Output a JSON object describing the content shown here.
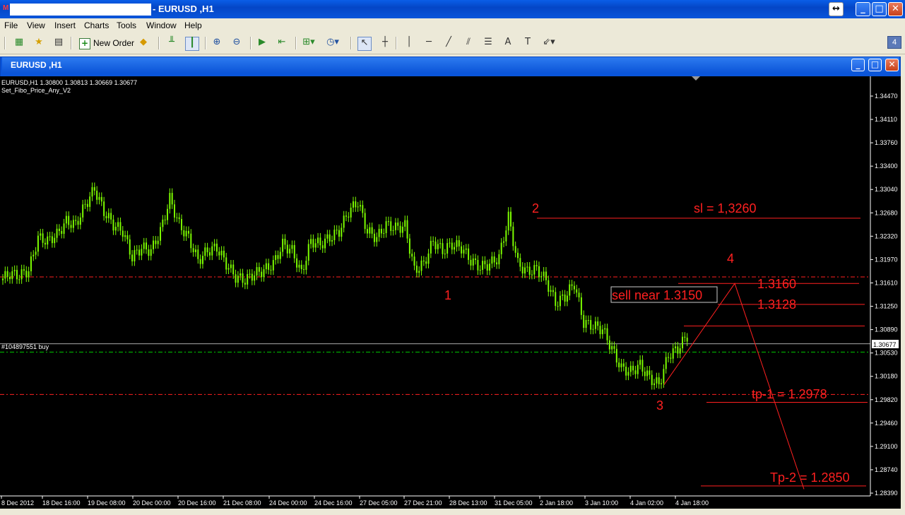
{
  "window": {
    "title": "- EURUSD ,H1",
    "app_icon": "M"
  },
  "menu": [
    "File",
    "View",
    "Insert",
    "Charts",
    "Tools",
    "Window",
    "Help"
  ],
  "toolbar": {
    "new_order_label": "New Order",
    "badge": "4"
  },
  "inner_window": {
    "title": "EURUSD ,H1"
  },
  "chart_info": {
    "line1": "EURUSD,H1  1.30800 1.30813 1.30669 1.30677",
    "line2": "Set_Fibo_Price_Any_V2",
    "order_label": "#104897551 buy"
  },
  "chart_data": {
    "type": "line",
    "y_ticks": [
      "1.34470",
      "1.34110",
      "1.33760",
      "1.33400",
      "1.33040",
      "1.32680",
      "1.32320",
      "1.31970",
      "1.31610",
      "1.31250",
      "1.30890",
      "1.30530",
      "1.30180",
      "1.29820",
      "1.29460",
      "1.29100",
      "1.28740",
      "1.28390"
    ],
    "current_price": "1.30677",
    "x_ticks": [
      "8 Dec 2012",
      "18 Dec 16:00",
      "19 Dec 08:00",
      "20 Dec 00:00",
      "20 Dec 16:00",
      "21 Dec 08:00",
      "24 Dec 00:00",
      "24 Dec 16:00",
      "27 Dec 05:00",
      "27 Dec 21:00",
      "28 Dec 13:00",
      "31 Dec 05:00",
      "2 Jan 18:00",
      "3 Jan 10:00",
      "4 Jan 02:00",
      "4 Jan 18:00"
    ],
    "ylim": [
      1.2839,
      1.3447
    ],
    "price_series": [
      1.3165,
      1.3175,
      1.3172,
      1.318,
      1.323,
      1.3225,
      1.3235,
      1.3255,
      1.325,
      1.328,
      1.3305,
      1.327,
      1.325,
      1.324,
      1.32,
      1.3215,
      1.321,
      1.324,
      1.329,
      1.325,
      1.323,
      1.3195,
      1.321,
      1.3215,
      1.319,
      1.317,
      1.3165,
      1.3175,
      1.318,
      1.319,
      1.322,
      1.321,
      1.3175,
      1.3225,
      1.322,
      1.323,
      1.324,
      1.327,
      1.3285,
      1.324,
      1.323,
      1.325,
      1.3245,
      1.3248,
      1.318,
      1.319,
      1.3225,
      1.321,
      1.322,
      1.3215,
      1.3195,
      1.3185,
      1.319,
      1.32,
      1.3262,
      1.319,
      1.3178,
      1.3182,
      1.3165,
      1.313,
      1.314,
      1.316,
      1.31,
      1.3095,
      1.309,
      1.306,
      1.303,
      1.3025,
      1.3035,
      1.3015,
      1.3005,
      1.305,
      1.306,
      1.308
    ],
    "annotations": {
      "label_1": "1",
      "label_2": "2",
      "label_3": "3",
      "label_4": "4",
      "sl": "sl = 1,3260",
      "sell": "sell near 1.3150",
      "level_1": "1.3160",
      "level_2": "1.3128",
      "tp1": "tp-1 = 1.2978",
      "tp2": "Tp-2 = 1.2850"
    },
    "colors": {
      "background": "#000000",
      "candles": "#7cfc00",
      "annotation": "#ff2020",
      "level_line": "#ff2020",
      "buy_line": "#00cc00"
    }
  }
}
